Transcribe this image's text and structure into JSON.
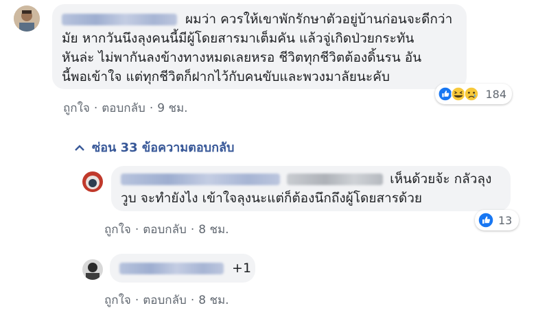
{
  "comment1": {
    "text_lines": [
      "ผมว่า ควรให้เขาพักรักษาตัวอยู่บ้านก่อนจะดีกว่า",
      "มัย หากวันนึงลุงคนนี้มีผู้โดยสารมาเต็มคัน แล้วจู่เกิดป่วยกระทัน",
      "หันล่ะ ไม่พากันลงข้างทางหมดเลยหรอ ชีวิตทุกชีวิตต้องดิ้นรน อัน",
      "นี้พอเข้าใจ แต่ทุกชีวิตก็ฝากไว้กับคนขับและพวงมาลัยนะคับ"
    ],
    "like_label": "ถูกใจ",
    "reply_label": "ตอบกลับ",
    "time": "9 ชม.",
    "reaction_count": "184",
    "reaction_icons": [
      "like-icon",
      "haha-icon",
      "sad-icon"
    ]
  },
  "hide_replies_label": "ซ่อน 33 ข้อความตอบกลับ",
  "reply1": {
    "text_lines": [
      "เห็นด้วยจ้ะ กลัวลุง",
      "วูบ จะทำยังไง เข้าใจลุงนะแต่ก็ต้องนึกถึงผู้โดยสารด้วย"
    ],
    "like_label": "ถูกใจ",
    "reply_label": "ตอบกลับ",
    "time": "8 ชม.",
    "reaction_count": "13",
    "reaction_icons": [
      "like-icon"
    ]
  },
  "reply2": {
    "text": "+1",
    "like_label": "ถูกใจ",
    "reply_label": "ตอบกลับ",
    "time": "8 ชม."
  },
  "colors": {
    "bubble": "#f2f3f5",
    "link_blue": "#385898",
    "meta_gray": "#606770",
    "like_blue": "#1877f2"
  }
}
